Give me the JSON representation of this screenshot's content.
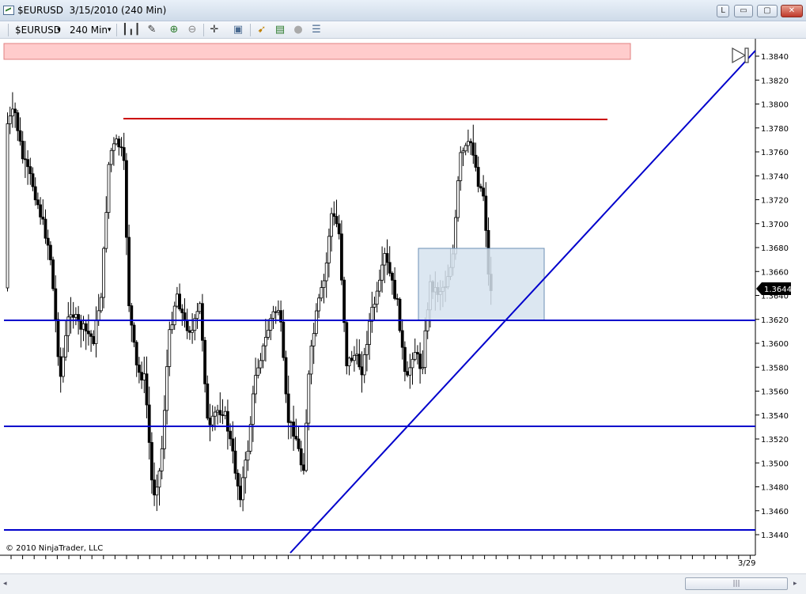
{
  "window": {
    "title": "$EURUSD  3/15/2010 (240 Min)",
    "buttons": {
      "l": "L",
      "minimize": "▭",
      "maximize": "▢",
      "close": "✕"
    }
  },
  "toolbar": {
    "instrument": "$EURUSD",
    "interval": "240 Min",
    "dropdown_glyph": "▾"
  },
  "chart": {
    "copyright": "© 2010 NinjaTrader, LLC",
    "date_label": "3/29",
    "y_ticks": [
      "1.3840",
      "1.3820",
      "1.3800",
      "1.3780",
      "1.3760",
      "1.3740",
      "1.3720",
      "1.3700",
      "1.3680",
      "1.3660",
      "1.3640",
      "1.3620",
      "1.3600",
      "1.3580",
      "1.3560",
      "1.3540",
      "1.3520",
      "1.3500",
      "1.3480",
      "1.3460",
      "1.3440"
    ],
    "last_price": "1.3644",
    "colors": {
      "support": "#0000cc",
      "resistance": "#cc0000",
      "zone_fill": "#d6e3ef",
      "zone_border": "#6b8fb5",
      "top_band": "#ffcccc",
      "candle": "#000000",
      "price_tag": "#000000"
    }
  },
  "scrollbar": {
    "thumb_grip": "|||"
  }
}
